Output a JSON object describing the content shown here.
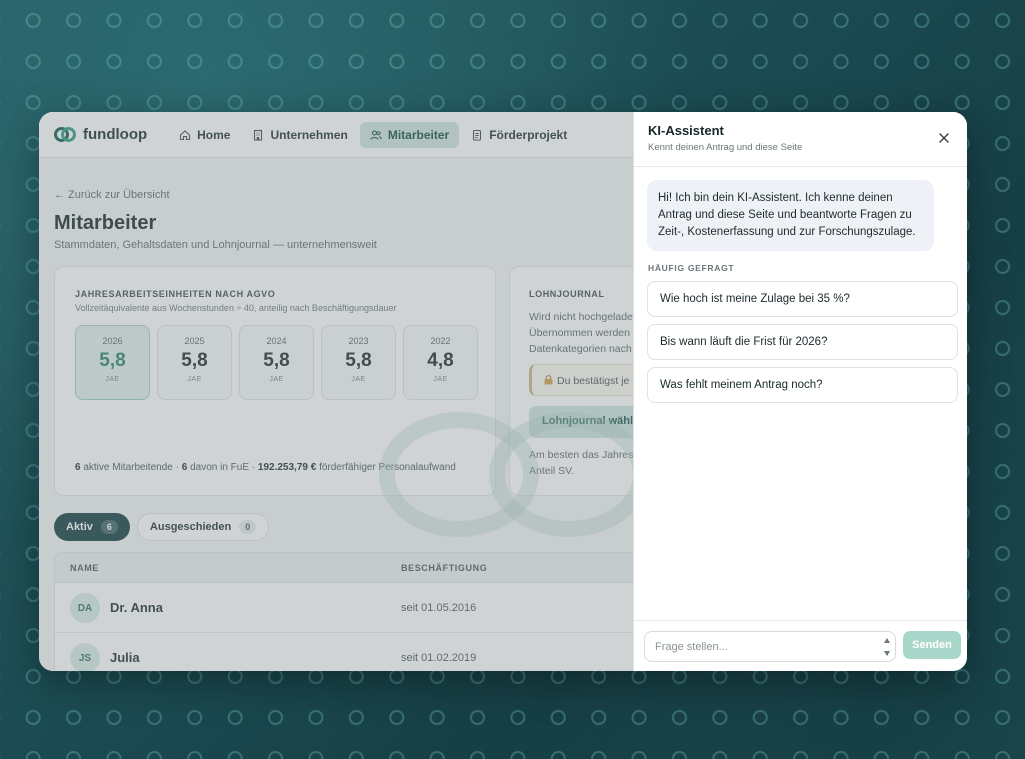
{
  "app": {
    "brand": "fundloop",
    "nav": [
      {
        "label": "Home",
        "icon": "home-icon"
      },
      {
        "label": "Unternehmen",
        "icon": "building-icon"
      },
      {
        "label": "Mitarbeiter",
        "icon": "users-icon",
        "active": true
      },
      {
        "label": "Förderprojekt",
        "icon": "document-icon"
      }
    ]
  },
  "page": {
    "back": "← Zurück zur Übersicht",
    "title": "Mitarbeiter",
    "subtitle": "Stammdaten, Gehaltsdaten und Lohnjournal — unternehmensweit"
  },
  "jae_card": {
    "label": "JAHRESARBEITSEINHEITEN NACH AGVO",
    "description": "Vollzeitäquivalente aus Wochenstunden ÷ 40, anteilig nach Beschäftigungsdauer",
    "unit": "JAE",
    "years": [
      {
        "year": "2026",
        "value": "5,8",
        "active": true
      },
      {
        "year": "2025",
        "value": "5,8"
      },
      {
        "year": "2024",
        "value": "5,8"
      },
      {
        "year": "2023",
        "value": "5,8"
      },
      {
        "year": "2022",
        "value": "4,8"
      }
    ],
    "footer": {
      "active_count": "6",
      "active_text": "aktive Mitarbeitende ·",
      "fue_count": "6",
      "fue_text": "davon in FuE ·",
      "amount": "192.253,79 €",
      "amount_text": "förderfähiger Personalaufwand"
    }
  },
  "lohn_card": {
    "label": "LOHNJOURNAL",
    "text_lines": [
      "Wird nicht hochgelade",
      "Übernommen werden",
      "Datenkategorien nach"
    ],
    "note": "Du bestätigst je",
    "button": "Lohnjournal wähle",
    "hint_lines": [
      "Am besten das Jahres",
      "Anteil SV."
    ]
  },
  "tabs": [
    {
      "label": "Aktiv",
      "count": "6",
      "active": true
    },
    {
      "label": "Ausgeschieden",
      "count": "0"
    }
  ],
  "table": {
    "headers": {
      "name": "NAME",
      "employment": "BESCHÄFTIGUNG"
    },
    "rows": [
      {
        "initials": "DA",
        "name": "Dr. Anna",
        "since": "seit 01.05.2016"
      },
      {
        "initials": "JS",
        "name": "Julia",
        "since": "seit 01.02.2019"
      }
    ]
  },
  "assistant": {
    "title": "KI-Assistent",
    "subtitle": "Kennt deinen Antrag und diese Seite",
    "greeting": "Hi! Ich bin dein KI-Assistent. Ich kenne deinen Antrag und diese Seite und beantworte Fragen zu Zeit-, Kostenerfassung und zur Forschungszulage.",
    "faq_label": "HÄUFIG GEFRAGT",
    "faq": [
      "Wie hoch ist meine Zulage bei 35 %?",
      "Bis wann läuft die Frist für 2026?",
      "Was fehlt meinem Antrag noch?"
    ],
    "input_placeholder": "Frage stellen...",
    "send_label": "Senden"
  },
  "colors": {
    "accent": "#2b7e69",
    "accent_light": "#cfe6df",
    "dark": "#0f3a40",
    "background": "#1f5258"
  }
}
